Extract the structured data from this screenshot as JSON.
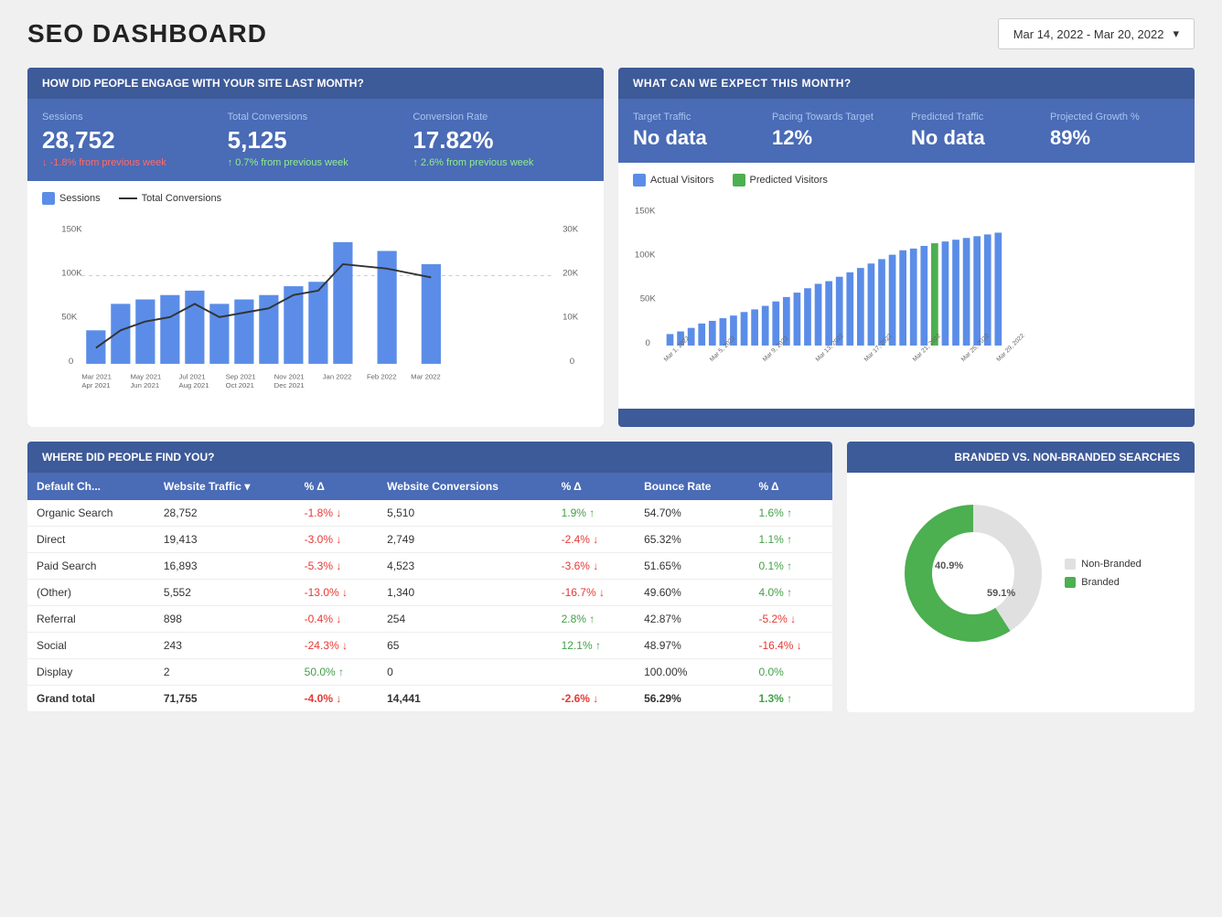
{
  "header": {
    "title": "SEO DASHBOARD",
    "date_range": "Mar 14, 2022 - Mar 20, 2022"
  },
  "engagement": {
    "section_title": "HOW DID PEOPLE ENGAGE WITH YOUR SITE LAST MONTH?",
    "metrics": [
      {
        "label": "Sessions",
        "value": "28,752",
        "change": "-1.8% from previous week",
        "direction": "negative"
      },
      {
        "label": "Total Conversions",
        "value": "5,125",
        "change": "0.7% from previous week",
        "direction": "positive"
      },
      {
        "label": "Conversion Rate",
        "value": "17.82%",
        "change": "2.6% from previous week",
        "direction": "positive"
      }
    ],
    "chart_legend": [
      {
        "label": "Sessions",
        "type": "bar",
        "color": "#5b8de8"
      },
      {
        "label": "Total Conversions",
        "type": "line",
        "color": "#333"
      }
    ]
  },
  "expect": {
    "section_title": "WHAT CAN WE EXPECT THIS MONTH?",
    "metrics": [
      {
        "label": "Target Traffic",
        "value": "No data"
      },
      {
        "label": "Pacing Towards Target",
        "value": "12%"
      },
      {
        "label": "Predicted Traffic",
        "value": "No data"
      },
      {
        "label": "Projected Growth %",
        "value": "89%"
      }
    ],
    "chart_legend": [
      {
        "label": "Actual Visitors",
        "type": "bar",
        "color": "#5b8de8"
      },
      {
        "label": "Predicted Visitors",
        "type": "bar",
        "color": "#4caf50"
      }
    ]
  },
  "where": {
    "section_title": "WHERE DID PEOPLE FIND YOU?",
    "columns": [
      "Default Ch...",
      "Website Traffic ▾",
      "% Δ",
      "Website Conversions",
      "% Δ",
      "Bounce Rate",
      "% Δ"
    ],
    "rows": [
      {
        "channel": "Organic Search",
        "traffic": "28,752",
        "traffic_delta": "-1.8% ↓",
        "traffic_dir": "neg",
        "conversions": "5,510",
        "conv_delta": "1.9% ↑",
        "conv_dir": "pos",
        "bounce": "54.70%",
        "bounce_delta": "1.6% ↑",
        "bounce_dir": "pos"
      },
      {
        "channel": "Direct",
        "traffic": "19,413",
        "traffic_delta": "-3.0% ↓",
        "traffic_dir": "neg",
        "conversions": "2,749",
        "conv_delta": "-2.4% ↓",
        "conv_dir": "neg",
        "bounce": "65.32%",
        "bounce_delta": "1.1% ↑",
        "bounce_dir": "pos"
      },
      {
        "channel": "Paid Search",
        "traffic": "16,893",
        "traffic_delta": "-5.3% ↓",
        "traffic_dir": "neg",
        "conversions": "4,523",
        "conv_delta": "-3.6% ↓",
        "conv_dir": "neg",
        "bounce": "51.65%",
        "bounce_delta": "0.1% ↑",
        "bounce_dir": "pos"
      },
      {
        "channel": "(Other)",
        "traffic": "5,552",
        "traffic_delta": "-13.0% ↓",
        "traffic_dir": "neg",
        "conversions": "1,340",
        "conv_delta": "-16.7% ↓",
        "conv_dir": "neg",
        "bounce": "49.60%",
        "bounce_delta": "4.0% ↑",
        "bounce_dir": "pos"
      },
      {
        "channel": "Referral",
        "traffic": "898",
        "traffic_delta": "-0.4% ↓",
        "traffic_dir": "neg",
        "conversions": "254",
        "conv_delta": "2.8% ↑",
        "conv_dir": "pos",
        "bounce": "42.87%",
        "bounce_delta": "-5.2% ↓",
        "bounce_dir": "neg"
      },
      {
        "channel": "Social",
        "traffic": "243",
        "traffic_delta": "-24.3% ↓",
        "traffic_dir": "neg",
        "conversions": "65",
        "conv_delta": "12.1% ↑",
        "conv_dir": "pos",
        "bounce": "48.97%",
        "bounce_delta": "-16.4% ↓",
        "bounce_dir": "neg"
      },
      {
        "channel": "Display",
        "traffic": "2",
        "traffic_delta": "50.0% ↑",
        "traffic_dir": "pos",
        "conversions": "0",
        "conv_delta": "",
        "conv_dir": "",
        "bounce": "100.00%",
        "bounce_delta": "0.0%",
        "bounce_dir": ""
      }
    ],
    "grand_total": {
      "label": "Grand total",
      "traffic": "71,755",
      "traffic_delta": "-4.0% ↓",
      "traffic_dir": "neg",
      "conversions": "14,441",
      "conv_delta": "-2.6% ↓",
      "conv_dir": "neg",
      "bounce": "56.29%",
      "bounce_delta": "1.3% ↑",
      "bounce_dir": "pos"
    }
  },
  "branded": {
    "section_title": "BRANDED VS. NON-BRANDED SEARCHES",
    "non_branded_pct": 40.9,
    "branded_pct": 59.1,
    "legend": [
      {
        "label": "Non-Branded",
        "color": "#e0e0e0"
      },
      {
        "label": "Branded",
        "color": "#4caf50"
      }
    ]
  },
  "colors": {
    "blue_bar": "#5b8de8",
    "green_bar": "#4caf50",
    "header_bg": "#3d5a99",
    "subheader_bg": "#4a6bb5"
  }
}
